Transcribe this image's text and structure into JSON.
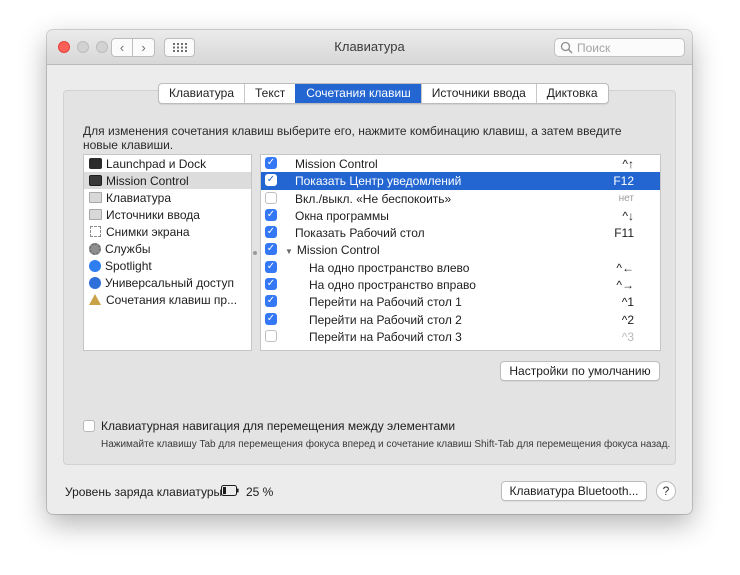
{
  "window": {
    "title": "Клавиатура"
  },
  "search": {
    "placeholder": "Поиск"
  },
  "tabs": [
    {
      "label": "Клавиатура",
      "active": false
    },
    {
      "label": "Текст",
      "active": false
    },
    {
      "label": "Сочетания клавиш",
      "active": true
    },
    {
      "label": "Источники ввода",
      "active": false
    },
    {
      "label": "Диктовка",
      "active": false
    }
  ],
  "instructions": "Для изменения сочетания клавиш выберите его, нажмите комбинацию клавиш, а затем введите новые клавиши.",
  "categories": [
    {
      "label": "Launchpad и Dock",
      "icon": "launchpad-dock-icon"
    },
    {
      "label": "Mission Control",
      "icon": "mission-control-icon"
    },
    {
      "label": "Клавиатура",
      "icon": "keyboard-icon"
    },
    {
      "label": "Источники ввода",
      "icon": "input-sources-icon"
    },
    {
      "label": "Снимки экрана",
      "icon": "screenshot-icon"
    },
    {
      "label": "Службы",
      "icon": "gear-icon"
    },
    {
      "label": "Spotlight",
      "icon": "spotlight-icon"
    },
    {
      "label": "Универсальный доступ",
      "icon": "accessibility-icon"
    },
    {
      "label": "Сочетания клавиш пр...",
      "icon": "app-shortcuts-icon"
    }
  ],
  "shortcuts": [
    {
      "label": "Mission Control",
      "key": "^↑",
      "checked": true
    },
    {
      "label": "Показать Центр уведомлений",
      "key": "F12",
      "checked": true
    },
    {
      "label": "Вкл./выкл. «Не беспокоить»",
      "key": "нет",
      "checked": false
    },
    {
      "label": "Окна программы",
      "key": "^↓",
      "checked": true
    },
    {
      "label": "Показать Рабочий стол",
      "key": "F11",
      "checked": true
    },
    {
      "label": "Mission Control",
      "key": "",
      "checked": true
    },
    {
      "label": "На одно пространство влево",
      "key": "^←",
      "checked": true
    },
    {
      "label": "На одно пространство вправо",
      "key": "^→",
      "checked": true
    },
    {
      "label": "Перейти на Рабочий стол 1",
      "key": "^1",
      "checked": true
    },
    {
      "label": "Перейти на Рабочий стол 2",
      "key": "^2",
      "checked": true
    },
    {
      "label": "Перейти на Рабочий стол 3",
      "key": "^3",
      "checked": false
    }
  ],
  "defaults_button": "Настройки по умолчанию",
  "keyboard_navigation": {
    "label": "Клавиатурная навигация для перемещения между элементами",
    "hint": "Нажимайте клавишу Tab для перемещения фокуса вперед и сочетание клавиш Shift-Tab для перемещения фокуса назад."
  },
  "battery": {
    "label": "Уровень заряда клавиатуры:",
    "value": "25 %"
  },
  "bluetooth_button": "Клавиатура Bluetooth...",
  "help_label": "?",
  "colors": {
    "accent": "#2466d1",
    "checkbox": "#3478f6"
  }
}
